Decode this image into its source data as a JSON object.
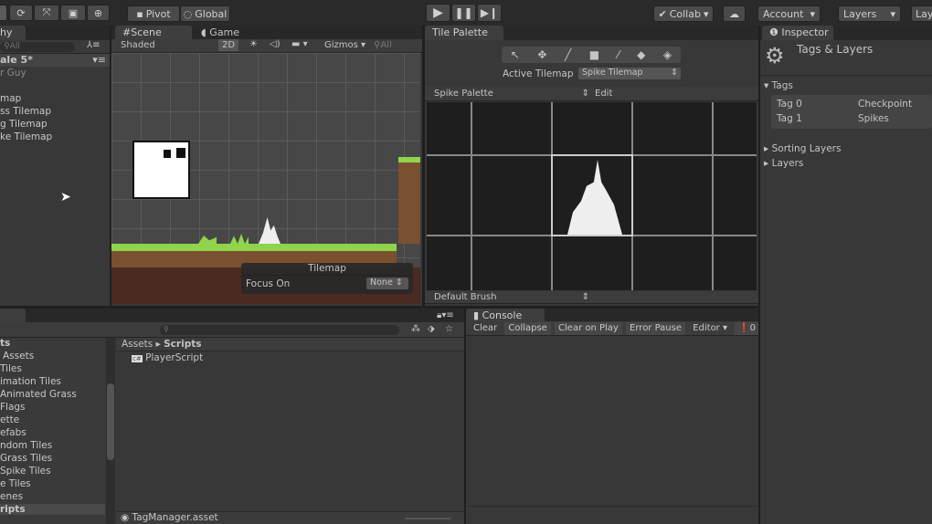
{
  "toolbar": {
    "transform_tools": [
      "rotate-icon",
      "scale-icon",
      "rect-icon",
      "transform-icon"
    ],
    "pivot": "Pivot",
    "global": "Global",
    "collab": "Collab",
    "account": "Account",
    "layers": "Layers",
    "layout": "Lay"
  },
  "hierarchy": {
    "tab": "hy",
    "search_placeholder": "All",
    "scene": "ale 5*",
    "items": [
      "r Guy",
      "",
      "map",
      "ss Tilemap",
      "g Tilemap",
      "ke Tilemap"
    ]
  },
  "scene": {
    "tab_scene": "Scene",
    "tab_game": "Game",
    "shading": "Shaded",
    "mode2d": "2D",
    "gizmos": "Gizmos",
    "search_placeholder": "All",
    "overlay_title": "Tilemap",
    "focus_label": "Focus On",
    "focus_value": "None"
  },
  "palette": {
    "tab": "Tile Palette",
    "active_label": "Active Tilemap",
    "active_value": "Spike Tilemap",
    "palette_name": "Spike Palette",
    "edit": "Edit",
    "brush": "Default Brush"
  },
  "inspector": {
    "tab": "Inspector",
    "title": "Tags & Layers",
    "tags_header": "Tags",
    "tags": [
      {
        "name": "Tag 0",
        "value": "Checkpoint"
      },
      {
        "name": "Tag 1",
        "value": "Spikes"
      }
    ],
    "sorting_layers": "Sorting Layers",
    "layers": "Layers"
  },
  "project": {
    "tree": [
      "ts",
      "Assets",
      "Tiles",
      "imation Tiles",
      "Animated Grass",
      "Flags",
      "ette",
      "efabs",
      "ndom Tiles",
      "Grass Tiles",
      "Spike Tiles",
      "e Tiles",
      "enes",
      "ripts"
    ],
    "selected": "ripts",
    "breadcrumb_root": "Assets",
    "breadcrumb_current": "Scripts",
    "files": [
      "PlayerScript"
    ],
    "footer": "TagManager.asset"
  },
  "console": {
    "tab": "Console",
    "clear": "Clear",
    "collapse": "Collapse",
    "clear_on_play": "Clear on Play",
    "error_pause": "Error Pause",
    "editor": "Editor",
    "error_count": "0",
    "warn_count": "0"
  }
}
